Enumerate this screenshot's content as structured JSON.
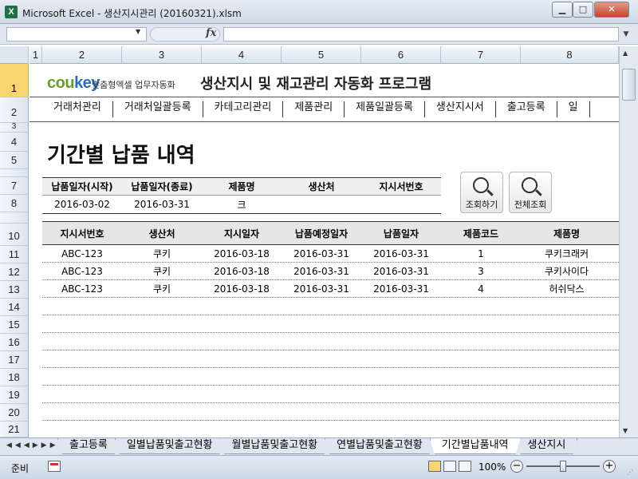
{
  "window": {
    "app_icon": "X",
    "title": "Microsoft Excel - 생산지시관리 (20160321).xlsm",
    "minimize_label": "▁",
    "maximize_label": "□",
    "close_label": "✕"
  },
  "formula_bar": {
    "name_box": "",
    "fx_label": "fx",
    "formula": ""
  },
  "columns": [
    "1",
    "2",
    "3",
    "4",
    "5",
    "6",
    "7",
    "8"
  ],
  "rows": [
    "1",
    "2",
    "3",
    "4",
    "5",
    "7",
    "8",
    "10",
    "11",
    "12",
    "13",
    "14",
    "15",
    "16",
    "17",
    "18",
    "19",
    "20",
    "21"
  ],
  "brand": {
    "logo_main": "cou",
    "logo_key": "key",
    "logo_sub": "맞춤형엑셀 업무자동화",
    "program_title": "생산지시 및 재고관리 자동화 프로그램"
  },
  "nav": [
    "거래처관리",
    "거래처일괄등록",
    "카테고리관리",
    "제품관리",
    "제품일괄등록",
    "생산지시서",
    "출고등록",
    "일"
  ],
  "page_title": "기간별 납품 내역",
  "filter": {
    "headers": [
      "납품일자(시작)",
      "납품일자(종료)",
      "제품명",
      "생산처",
      "지시서번호"
    ],
    "values": [
      "2016-03-02",
      "2016-03-31",
      "크",
      "",
      ""
    ]
  },
  "buttons": {
    "search": "조회하기",
    "all": "전체조회"
  },
  "results": {
    "headers": [
      "지시서번호",
      "생산처",
      "지시일자",
      "납품예정일자",
      "납품일자",
      "제품코드",
      "제품명"
    ],
    "rows": [
      [
        "ABC-123",
        "쿠키",
        "2016-03-18",
        "2016-03-31",
        "2016-03-31",
        "1",
        "쿠키크래커"
      ],
      [
        "ABC-123",
        "쿠키",
        "2016-03-18",
        "2016-03-31",
        "2016-03-31",
        "3",
        "쿠키사이다"
      ],
      [
        "ABC-123",
        "쿠키",
        "2016-03-18",
        "2016-03-31",
        "2016-03-31",
        "4",
        "허쉬닥스"
      ]
    ]
  },
  "sheet_tabs": [
    "출고등록",
    "일별납품및출고현황",
    "월별납품및출고현황",
    "연별납품및출고현황",
    "기간별납품내역",
    "생산지시"
  ],
  "active_tab": "기간별납품내역",
  "status": {
    "ready": "준비",
    "zoom": "100%",
    "zoom_minus": "−",
    "zoom_plus": "+"
  }
}
